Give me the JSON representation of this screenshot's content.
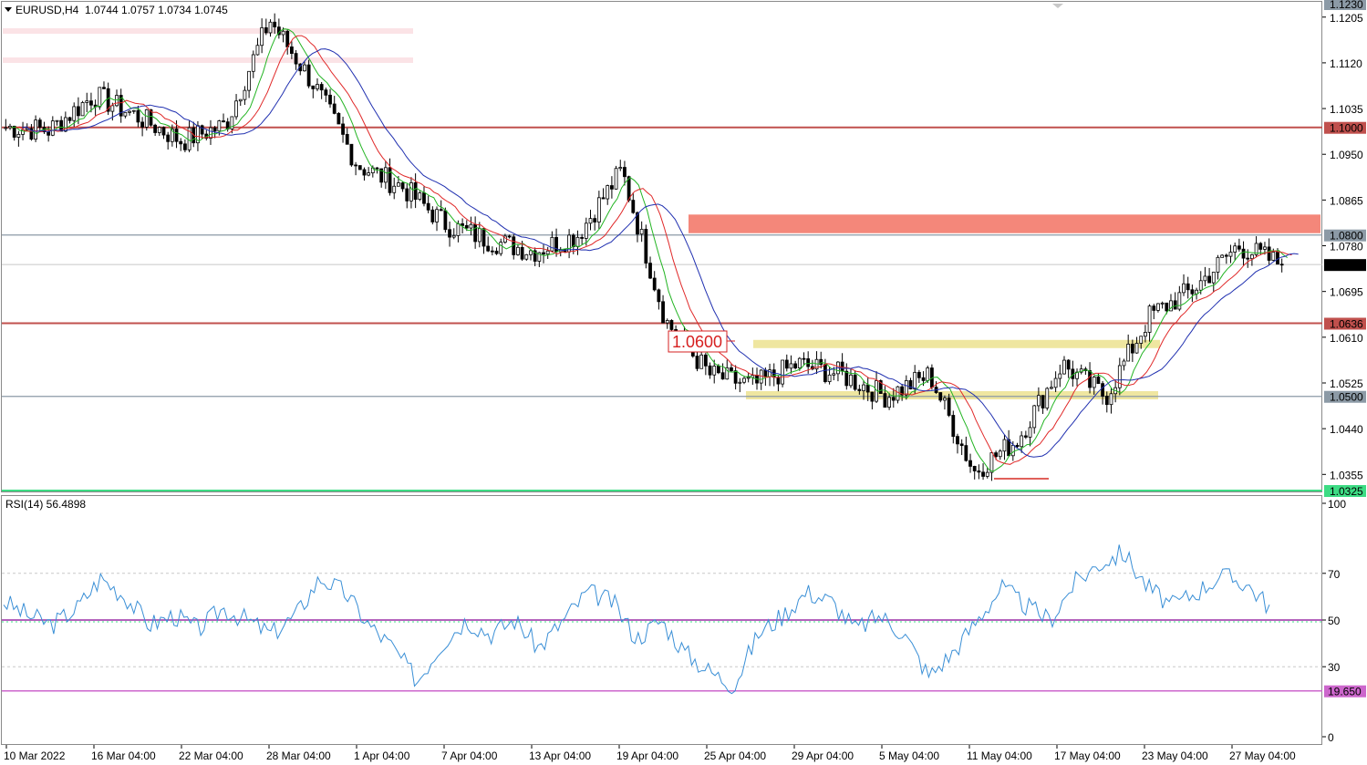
{
  "header": {
    "symbol": "EURUSD,H4",
    "ohlc": "1.0744 1.0757 1.0734 1.0745",
    "menu_arrow_icon": "triangle-down-icon"
  },
  "price_axis": {
    "ticks": [
      "1.1205",
      "1.1120",
      "1.1035",
      "1.0950",
      "1.0865",
      "1.0780",
      "1.0695",
      "1.0610",
      "1.0525",
      "1.0440",
      "1.0355"
    ],
    "tick_values": [
      1.1205,
      1.112,
      1.1035,
      1.095,
      1.0865,
      1.078,
      1.0695,
      1.061,
      1.0525,
      1.044,
      1.0355
    ],
    "range": [
      1.0325,
      1.123
    ]
  },
  "level_labels": [
    {
      "text": "1.1230",
      "value": 1.123,
      "color": "#8c9aa6",
      "line": false
    },
    {
      "text": "1.1000",
      "value": 1.1,
      "color": "#c0504d",
      "line": true
    },
    {
      "text": "1.0800",
      "value": 1.08,
      "color": "#8c9aa6",
      "line": true
    },
    {
      "text": "1.0745",
      "value": 1.0745,
      "color": "#000000",
      "line": false
    },
    {
      "text": "1.0636",
      "value": 1.0636,
      "color": "#c0504d",
      "line": true
    },
    {
      "text": "1.0500",
      "value": 1.05,
      "color": "#8c9aa6",
      "line": true
    },
    {
      "text": "1.0325",
      "value": 1.0325,
      "color": "#3ddc84",
      "line": true
    }
  ],
  "annotation": {
    "text": "1.0600",
    "value": 1.06,
    "color": "#d62020"
  },
  "rsi": {
    "title": "RSI(14) 56.4898",
    "ticks": [
      "100",
      "70",
      "50",
      "30",
      "0"
    ],
    "tick_values": [
      100,
      70,
      50,
      30,
      0
    ],
    "levels": [
      {
        "text": "19.650",
        "value": 19.65,
        "color": "#cc66cc"
      }
    ],
    "color": "#3a8fd6"
  },
  "time_axis": [
    "10 Mar 2022",
    "16 Mar 04:00",
    "22 Mar 04:00",
    "28 Mar 04:00",
    "1 Apr 04:00",
    "7 Apr 04:00",
    "13 Apr 04:00",
    "19 Apr 04:00",
    "25 Apr 04:00",
    "29 Apr 04:00",
    "5 May 04:00",
    "11 May 04:00",
    "17 May 04:00",
    "23 May 04:00",
    "27 May 04:00"
  ],
  "colors": {
    "bull": "#ffffff",
    "bear": "#000000",
    "ma_fast": "#22b422",
    "ma_mid": "#e02828",
    "ma_slow": "#2030b0",
    "resistance_zone": "#f4877a",
    "range_band": "#efe6a0",
    "top_band": "#fbe3e6"
  },
  "chart_data": [
    {
      "type": "candlestick",
      "title": "EURUSD,H4",
      "ylim": [
        1.0325,
        1.123
      ],
      "x": [
        "10 Mar 2022",
        "16 Mar 04:00",
        "22 Mar 04:00",
        "28 Mar 04:00",
        "1 Apr 04:00",
        "7 Apr 04:00",
        "13 Apr 04:00",
        "19 Apr 04:00",
        "25 Apr 04:00",
        "29 Apr 04:00",
        "5 May 04:00",
        "11 May 04:00",
        "17 May 04:00",
        "23 May 04:00",
        "27 May 04:00"
      ],
      "close_path": [
        1.1,
        1.0995,
        1.106,
        1.102,
        1.0975,
        1.1005,
        1.12,
        1.108,
        1.093,
        1.089,
        1.082,
        1.079,
        1.077,
        1.08,
        1.092,
        1.064,
        1.054,
        1.052,
        1.056,
        1.054,
        1.05,
        1.054,
        1.036,
        1.042,
        1.056,
        1.05,
        1.065,
        1.07,
        1.078,
        1.0745
      ],
      "last": 1.0745,
      "levels": [
        1.1,
        1.08,
        1.0636,
        1.05,
        1.0325
      ]
    },
    {
      "type": "line",
      "title": "RSI(14) 56.4898",
      "ylim": [
        0,
        100
      ],
      "values": [
        58,
        52,
        48,
        55,
        68,
        60,
        48,
        52,
        46,
        55,
        50,
        44,
        52,
        68,
        62,
        48,
        38,
        24,
        40,
        50,
        44,
        50,
        38,
        50,
        62,
        58,
        42,
        50,
        36,
        28,
        22,
        44,
        52,
        62,
        58,
        46,
        52,
        44,
        26,
        36,
        50,
        64,
        56,
        50,
        66,
        74,
        79,
        64,
        56,
        62,
        69,
        66,
        56
      ]
    }
  ]
}
